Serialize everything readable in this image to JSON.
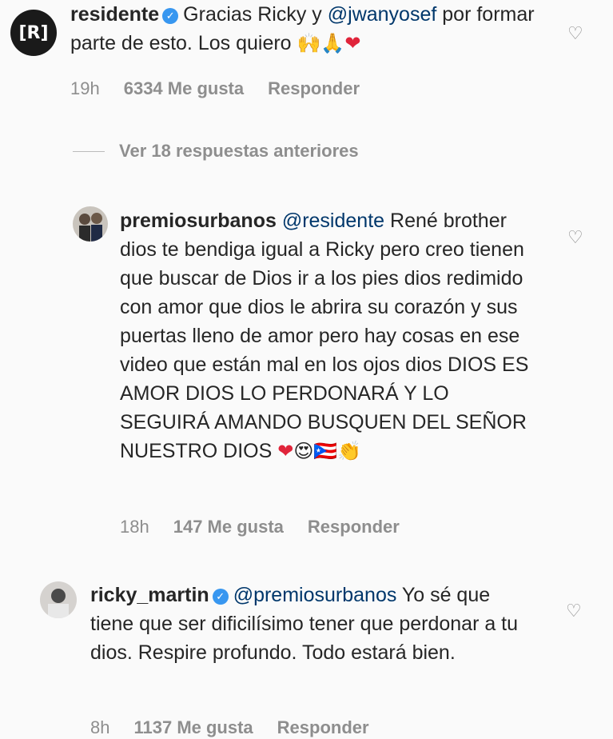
{
  "comments": [
    {
      "username": "residente",
      "avatar_text": "[R]",
      "verified": true,
      "body_parts": [
        "Gracias Ricky y ",
        "@jwanyosef",
        " por formar parte de esto. Los quiero "
      ],
      "emojis": [
        "🙌",
        "🙏",
        "❤"
      ],
      "time": "19h",
      "likes": "6334 Me gusta",
      "reply": "Responder"
    },
    {
      "username": "premiosurbanos",
      "mention": "@residente",
      "body": " René brother dios te bendiga igual a Ricky pero creo tienen que buscar de Dios ir a los pies dios redimido con amor que dios le abrira su corazón y sus puertas lleno de amor pero hay cosas en ese video que están mal en los ojos dios DIOS ES AMOR DIOS LO PERDONARÁ Y LO SEGUIRÁ AMANDO BUSQUEN DEL SEÑOR NUESTRO DIOS ",
      "emojis": [
        "❤",
        "😍",
        "🇵🇷",
        "👏"
      ],
      "time": "18h",
      "likes": "147 Me gusta",
      "reply": "Responder"
    },
    {
      "username": "ricky_martin",
      "verified": true,
      "mention": "@premiosurbanos",
      "body": " Yo sé que tiene que ser dificilísimo tener que perdonar a tu dios. Respire profundo. Todo estará bien.",
      "time": "8h",
      "likes": "1137 Me gusta",
      "reply": "Responder"
    }
  ],
  "view_replies": "Ver 18 respuestas anteriores",
  "icons": {
    "like": "heart-outline-icon",
    "verified": "verified-badge-icon"
  }
}
